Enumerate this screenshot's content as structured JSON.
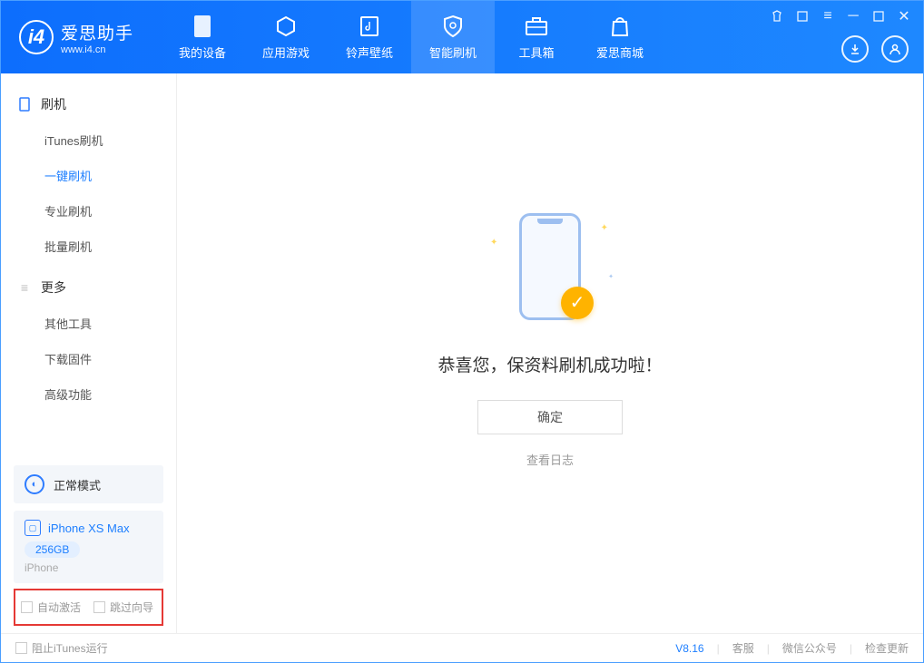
{
  "app": {
    "title": "爱思助手",
    "subtitle": "www.i4.cn"
  },
  "nav": {
    "tabs": [
      {
        "label": "我的设备"
      },
      {
        "label": "应用游戏"
      },
      {
        "label": "铃声壁纸"
      },
      {
        "label": "智能刷机"
      },
      {
        "label": "工具箱"
      },
      {
        "label": "爱思商城"
      }
    ]
  },
  "sidebar": {
    "section1": {
      "title": "刷机",
      "items": [
        "iTunes刷机",
        "一键刷机",
        "专业刷机",
        "批量刷机"
      ]
    },
    "section2": {
      "title": "更多",
      "items": [
        "其他工具",
        "下载固件",
        "高级功能"
      ]
    },
    "status": {
      "label": "正常模式"
    },
    "device": {
      "name": "iPhone XS Max",
      "storage": "256GB",
      "type": "iPhone"
    },
    "checkboxes": {
      "auto_activate": "自动激活",
      "skip_guide": "跳过向导"
    }
  },
  "main": {
    "success_message": "恭喜您，保资料刷机成功啦！",
    "confirm_button": "确定",
    "view_log": "查看日志"
  },
  "footer": {
    "block_itunes": "阻止iTunes运行",
    "version": "V8.16",
    "links": [
      "客服",
      "微信公众号",
      "检查更新"
    ]
  }
}
